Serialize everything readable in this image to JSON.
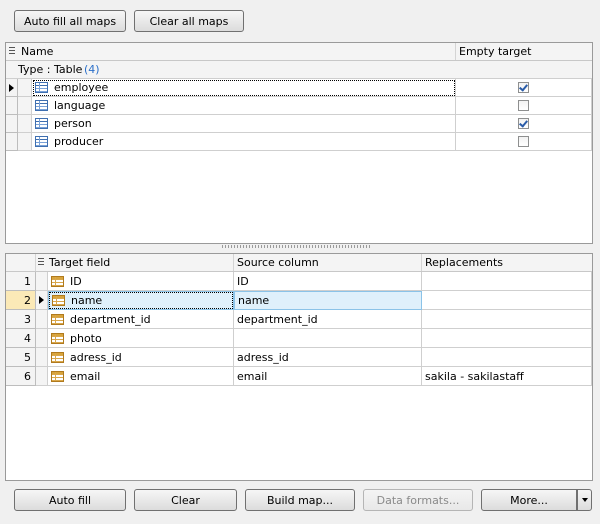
{
  "top_buttons": {
    "auto_fill_all": "Auto fill all maps",
    "clear_all": "Clear all maps"
  },
  "maps_grid": {
    "columns": {
      "name": "Name",
      "empty_target": "Empty target"
    },
    "group": {
      "label": "Type : Table",
      "count": "(4)"
    },
    "rows": [
      {
        "name": "employee",
        "empty_target": true
      },
      {
        "name": "language",
        "empty_target": false
      },
      {
        "name": "person",
        "empty_target": true
      },
      {
        "name": "producer",
        "empty_target": false
      }
    ]
  },
  "fields_grid": {
    "columns": {
      "target": "Target field",
      "source": "Source column",
      "replacements": "Replacements"
    },
    "rows": [
      {
        "num": "1",
        "target": "ID",
        "source": "ID",
        "replacements": ""
      },
      {
        "num": "2",
        "target": "name",
        "source": "name",
        "replacements": ""
      },
      {
        "num": "3",
        "target": "department_id",
        "source": "department_id",
        "replacements": ""
      },
      {
        "num": "4",
        "target": "photo",
        "source": "",
        "replacements": ""
      },
      {
        "num": "5",
        "target": "adress_id",
        "source": "adress_id",
        "replacements": ""
      },
      {
        "num": "6",
        "target": "email",
        "source": "email",
        "replacements": "sakila - sakilastaff"
      }
    ]
  },
  "bottom_buttons": {
    "auto_fill": "Auto fill",
    "clear": "Clear",
    "build_map": "Build map...",
    "data_formats": "Data formats...",
    "more": "More..."
  },
  "colors": {
    "selection": "#dff0fb",
    "current_indicator": "#fbe9b7",
    "accent": "#2a5ca8"
  }
}
